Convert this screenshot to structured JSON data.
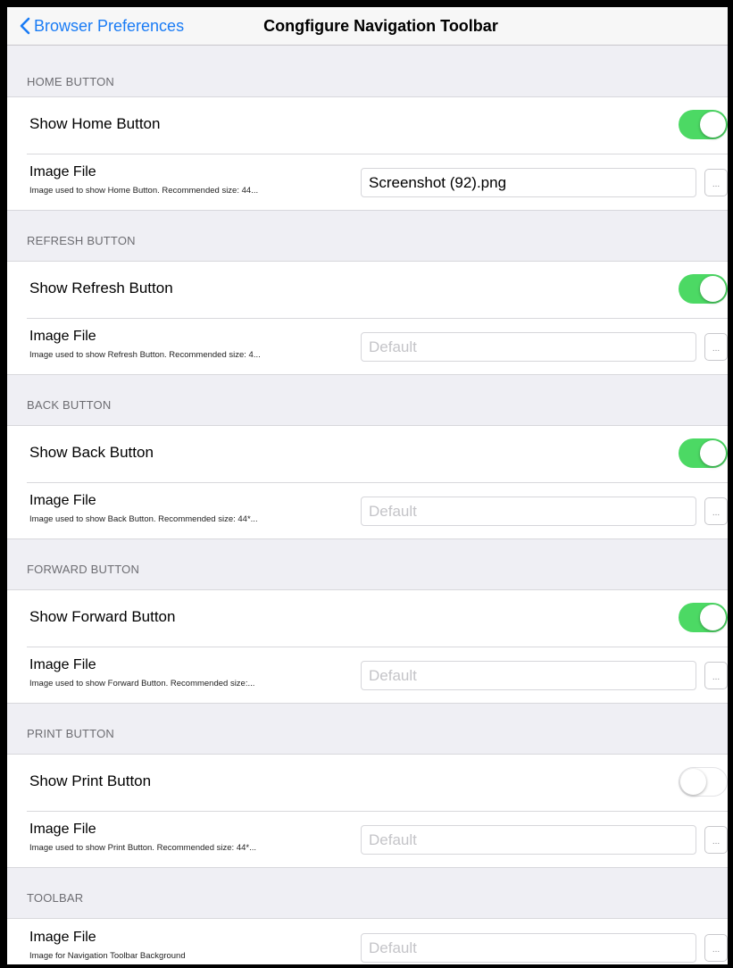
{
  "navbar": {
    "back_label": "Browser Preferences",
    "title": "Congfigure Navigation Toolbar"
  },
  "sections": [
    {
      "header": "HOME BUTTON",
      "toggle_label": "Show Home Button",
      "toggle_on": true,
      "file_title": "Image File",
      "file_desc": "Image used to show Home Button. Recommended size: 44...",
      "file_value": "Screenshot (92).png",
      "file_placeholder": "Default",
      "browse_label": "..."
    },
    {
      "header": "REFRESH BUTTON",
      "toggle_label": "Show Refresh Button",
      "toggle_on": true,
      "file_title": "Image File",
      "file_desc": "Image used to show Refresh Button. Recommended size: 4...",
      "file_value": "",
      "file_placeholder": "Default",
      "browse_label": "..."
    },
    {
      "header": "BACK BUTTON",
      "toggle_label": "Show Back Button",
      "toggle_on": true,
      "file_title": "Image File",
      "file_desc": "Image used to show Back Button. Recommended size: 44*...",
      "file_value": "",
      "file_placeholder": "Default",
      "browse_label": "..."
    },
    {
      "header": "FORWARD BUTTON",
      "toggle_label": "Show Forward Button",
      "toggle_on": true,
      "file_title": "Image File",
      "file_desc": "Image used to show Forward Button. Recommended size:...",
      "file_value": "",
      "file_placeholder": "Default",
      "browse_label": "..."
    },
    {
      "header": "PRINT BUTTON",
      "toggle_label": "Show Print Button",
      "toggle_on": false,
      "file_title": "Image File",
      "file_desc": "Image used to show Print Button. Recommended size: 44*...",
      "file_value": "",
      "file_placeholder": "Default",
      "browse_label": "..."
    },
    {
      "header": "TOOLBAR",
      "file_title": "Image File",
      "file_desc": "Image for Navigation Toolbar Background",
      "file_value": "",
      "file_placeholder": "Default",
      "browse_label": "..."
    }
  ],
  "icons": {
    "back": "chevron-left-icon"
  },
  "colors": {
    "accent": "#1a7cf5",
    "toggle_on": "#4cd964",
    "background": "#efeff4"
  }
}
